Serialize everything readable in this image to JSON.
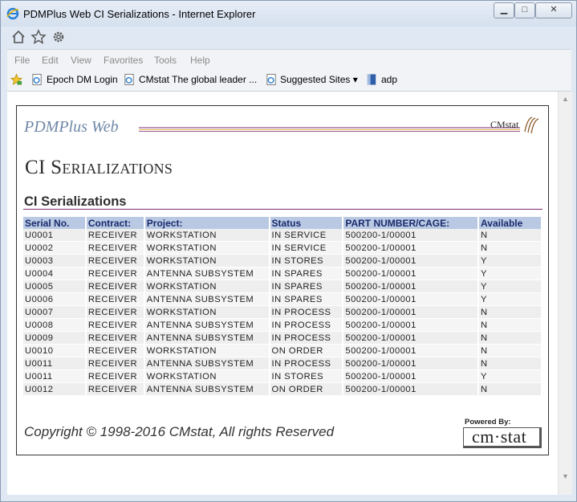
{
  "window": {
    "title": "PDMPlus Web CI Serializations - Internet Explorer",
    "min_glyph": "▁",
    "max_glyph": "□",
    "close_glyph": "✕"
  },
  "menu": [
    "File",
    "Edit",
    "View",
    "Favorites",
    "Tools",
    "Help"
  ],
  "favorites": {
    "items": [
      {
        "label": "Epoch DM Login"
      },
      {
        "label": "CMstat  The global leader ..."
      },
      {
        "label": "Suggested Sites ▾"
      },
      {
        "label": "adp"
      }
    ]
  },
  "page": {
    "brand": "PDMPlus Web",
    "logo_text": "CMstat",
    "big_title": "CI Serializations",
    "section_title": "CI Serializations",
    "copyright": "Copyright © 1998-2016 CMstat, All rights Reserved",
    "powered_label": "Powered By:",
    "powered_text": "cm·stat"
  },
  "table": {
    "columns": [
      "Serial No.",
      "Contract:",
      "Project:",
      "Status",
      "PART NUMBER/CAGE:",
      "Available"
    ],
    "rows": [
      [
        "U0001",
        "RECEIVER",
        "WORKSTATION",
        "IN SERVICE",
        "500200-1/00001",
        "N"
      ],
      [
        "U0002",
        "RECEIVER",
        "WORKSTATION",
        "IN SERVICE",
        "500200-1/00001",
        "N"
      ],
      [
        "U0003",
        "RECEIVER",
        "WORKSTATION",
        "IN STORES",
        "500200-1/00001",
        "Y"
      ],
      [
        "U0004",
        "RECEIVER",
        "ANTENNA SUBSYSTEM",
        "IN SPARES",
        "500200-1/00001",
        "Y"
      ],
      [
        "U0005",
        "RECEIVER",
        "WORKSTATION",
        "IN SPARES",
        "500200-1/00001",
        "Y"
      ],
      [
        "U0006",
        "RECEIVER",
        "ANTENNA SUBSYSTEM",
        "IN SPARES",
        "500200-1/00001",
        "Y"
      ],
      [
        "U0007",
        "RECEIVER",
        "WORKSTATION",
        "IN PROCESS",
        "500200-1/00001",
        "N"
      ],
      [
        "U0008",
        "RECEIVER",
        "ANTENNA SUBSYSTEM",
        "IN PROCESS",
        "500200-1/00001",
        "N"
      ],
      [
        "U0009",
        "RECEIVER",
        "ANTENNA SUBSYSTEM",
        "IN PROCESS",
        "500200-1/00001",
        "N"
      ],
      [
        "U0010",
        "RECEIVER",
        "WORKSTATION",
        "ON ORDER",
        "500200-1/00001",
        "N"
      ],
      [
        "U0011",
        "RECEIVER",
        "ANTENNA SUBSYSTEM",
        "IN PROCESS",
        "500200-1/00001",
        "N"
      ],
      [
        "U0011",
        "RECEIVER",
        "WORKSTATION",
        "IN STORES",
        "500200-1/00001",
        "Y"
      ],
      [
        "U0012",
        "RECEIVER",
        "ANTENNA SUBSYSTEM",
        "ON ORDER",
        "500200-1/00001",
        "N"
      ]
    ]
  },
  "colors": {
    "header_bg": "#b9c9e3",
    "header_text": "#1a2a6c",
    "rule": "#7b2a73",
    "brand": "#6f88a8"
  },
  "icons": {
    "title": "ie-logo-icon",
    "toolbar": [
      "home-icon",
      "star-icon",
      "gear-icon"
    ],
    "favorites": [
      "favorites-star-icon",
      "page-icon",
      "page-icon",
      "page-icon",
      "adp-icon"
    ]
  }
}
